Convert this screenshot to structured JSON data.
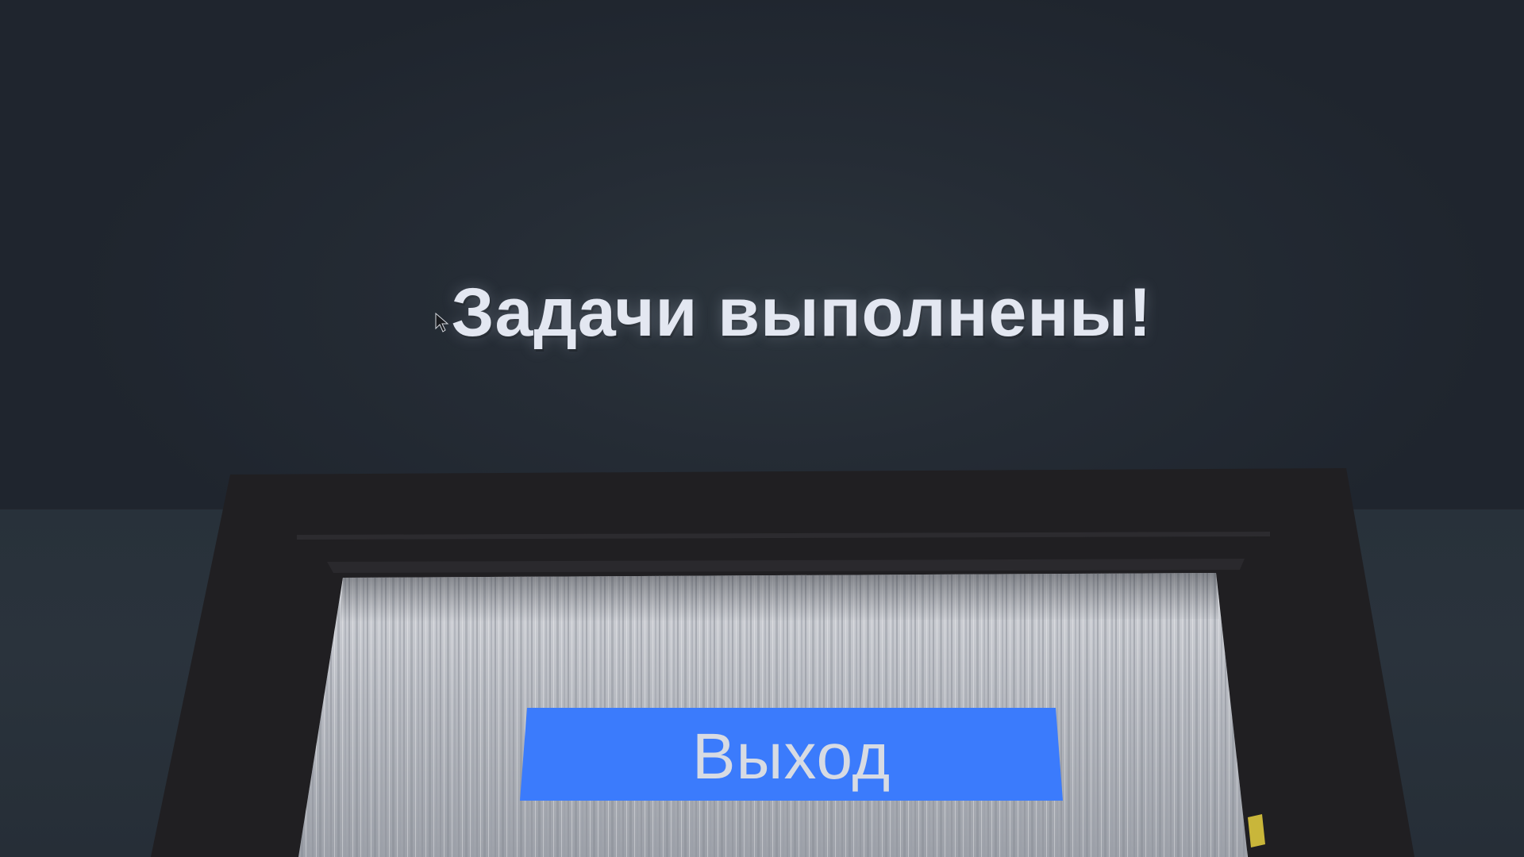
{
  "scene": {
    "title": "Задачи выполнены!",
    "exit_button_label": "Выход"
  },
  "icons": {
    "cursor": "mouse-pointer-icon"
  },
  "colors": {
    "background": "#1f252d",
    "wall_lower": "#28313a",
    "title_text": "#e3e7f1",
    "door_frame": "#201f22",
    "curtain": "#b9bcc3",
    "button": "#3b7bfc",
    "button_text": "#d7dbe3",
    "accent_yellow": "#c9b63a"
  }
}
